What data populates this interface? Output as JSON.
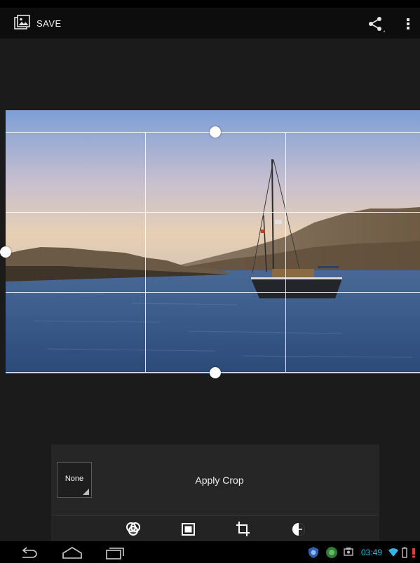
{
  "action_bar": {
    "save_label": "SAVE",
    "save_icon": "photo-save-icon",
    "share_icon": "share-icon",
    "overflow_icon": "overflow-menu-icon"
  },
  "crop_panel": {
    "aspect_button_label": "None",
    "apply_label": "Apply Crop"
  },
  "tools": [
    {
      "name": "filters-icon"
    },
    {
      "name": "frame-icon"
    },
    {
      "name": "crop-icon"
    },
    {
      "name": "adjust-exposure-icon"
    }
  ],
  "status": {
    "time": "03:49"
  },
  "colors": {
    "accent": "#33b5e5",
    "background": "#1b1b1b",
    "panel": "#262626"
  }
}
